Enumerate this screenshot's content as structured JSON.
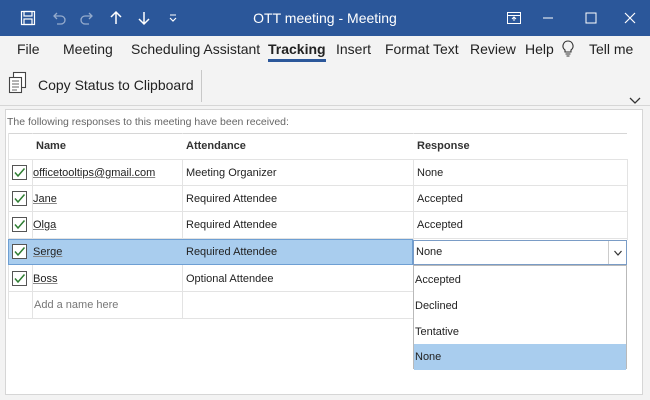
{
  "window": {
    "title": "OTT meeting  -  Meeting",
    "accent": "#2b579a"
  },
  "quick_access": {
    "icons": [
      "save-icon",
      "undo-icon",
      "redo-icon",
      "up-arrow-icon",
      "down-arrow-icon",
      "customize-icon"
    ]
  },
  "tabs": [
    {
      "label": "File"
    },
    {
      "label": "Meeting"
    },
    {
      "label": "Scheduling Assistant"
    },
    {
      "label": "Tracking",
      "active": true
    },
    {
      "label": "Insert"
    },
    {
      "label": "Format Text"
    },
    {
      "label": "Review"
    },
    {
      "label": "Help"
    },
    {
      "label": "Tell me"
    }
  ],
  "ribbon": {
    "copy_status_label": "Copy Status to Clipboard"
  },
  "tracking": {
    "info_text": "The following responses to this meeting have been received:",
    "columns": {
      "name": "Name",
      "attendance": "Attendance",
      "response": "Response"
    },
    "rows": [
      {
        "name": "officetooltips@gmail.com",
        "attendance": "Meeting Organizer",
        "response": "None",
        "checked": true
      },
      {
        "name": "Jane",
        "attendance": "Required Attendee",
        "response": "Accepted",
        "checked": true
      },
      {
        "name": "Olga",
        "attendance": "Required Attendee",
        "response": "Accepted",
        "checked": true
      },
      {
        "name": "Serge",
        "attendance": "Required Attendee",
        "response": "None",
        "checked": true,
        "selected": true
      },
      {
        "name": "Boss",
        "attendance": "Optional Attendee",
        "response": "",
        "checked": true
      }
    ],
    "add_placeholder": "Add a name here",
    "dropdown": {
      "value": "None",
      "options": [
        "Accepted",
        "Declined",
        "Tentative",
        "None"
      ],
      "highlighted": "None"
    }
  },
  "colors": {
    "selection": "#a9cdee",
    "checkmark": "#2e7d32"
  }
}
